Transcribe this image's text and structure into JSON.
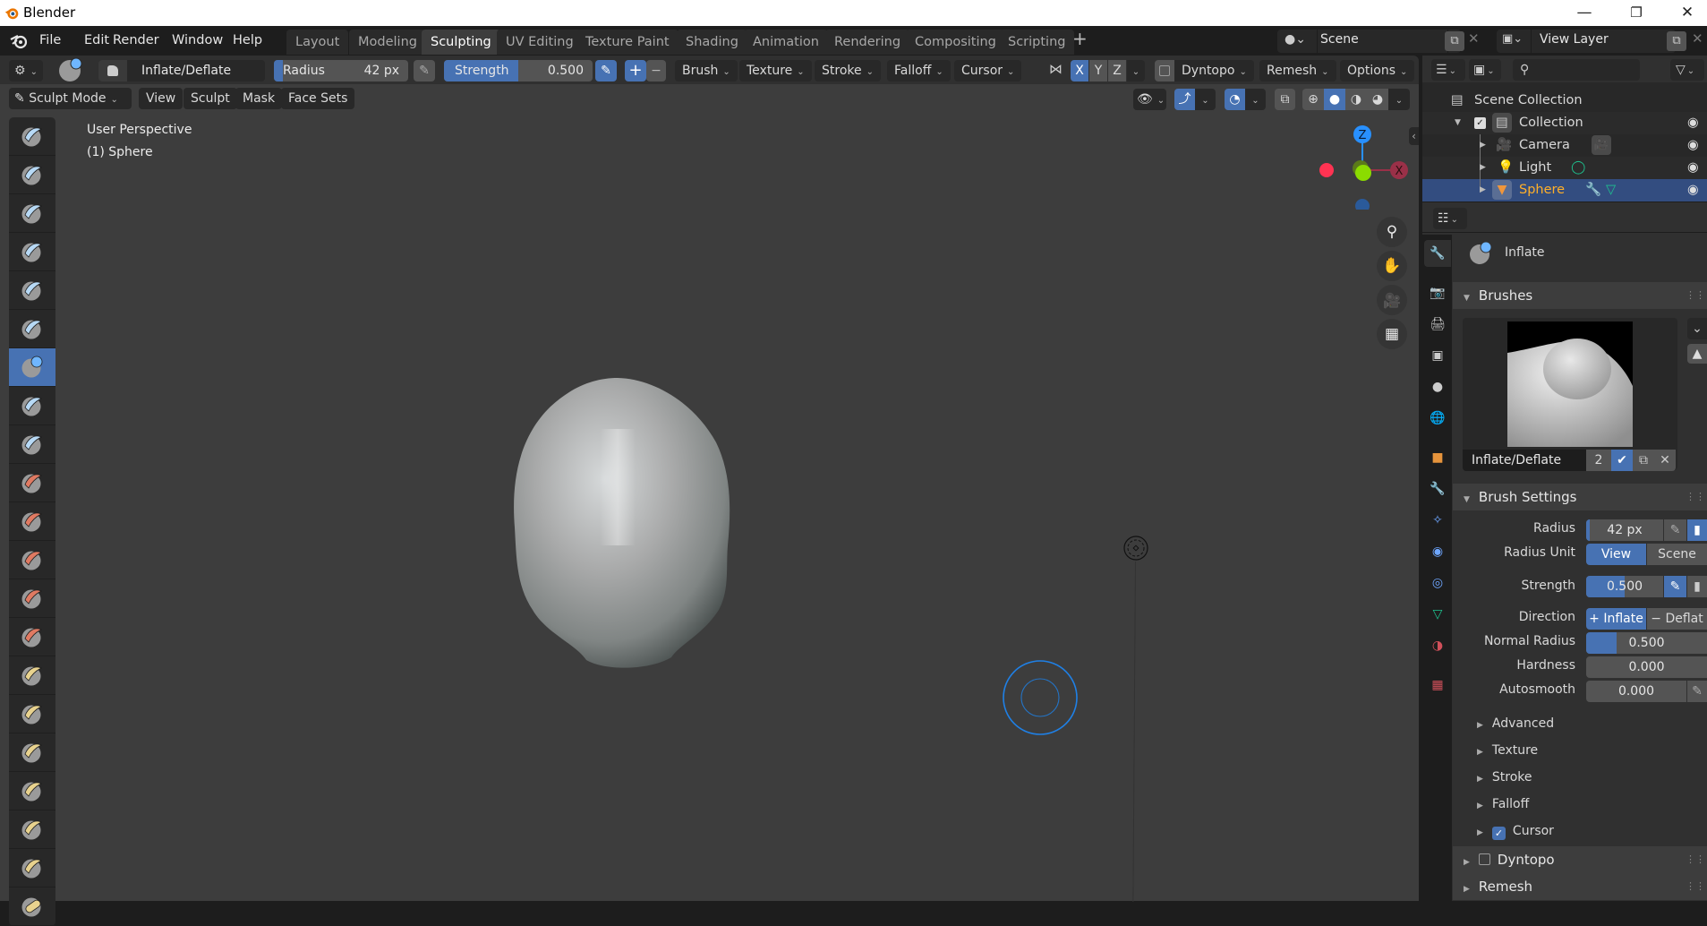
{
  "window": {
    "title": "Blender",
    "controls": [
      "minimize",
      "maximize",
      "close"
    ]
  },
  "menubar": {
    "items": [
      "File",
      "Edit",
      "Render",
      "Window",
      "Help"
    ]
  },
  "workspaces": {
    "tabs": [
      "Layout",
      "Modeling",
      "Sculpting",
      "UV Editing",
      "Texture Paint",
      "Shading",
      "Animation",
      "Rendering",
      "Compositing",
      "Scripting"
    ],
    "active": "Sculpting",
    "add_label": "+"
  },
  "scene": {
    "name": "Scene"
  },
  "view_layer": {
    "name": "View Layer"
  },
  "tool_header": {
    "brush_name": "Inflate/Deflate",
    "radius_label": "Radius",
    "radius_value": "42 px",
    "strength_label": "Strength",
    "strength_value": "0.500",
    "strength_fraction": 0.5,
    "plus": "+",
    "minus": "−",
    "menus": [
      "Brush",
      "Texture",
      "Stroke",
      "Falloff",
      "Cursor"
    ],
    "symmetry": [
      "X",
      "Y",
      "Z"
    ],
    "symmetry_active": "X",
    "dyntopo_label": "Dyntopo",
    "remesh_label": "Remesh",
    "options_label": "Options"
  },
  "mode_header": {
    "mode": "Sculpt Mode",
    "menus": [
      "View",
      "Sculpt",
      "Mask",
      "Face Sets"
    ]
  },
  "viewport": {
    "perspective_label": "User Perspective",
    "object_label": "(1) Sphere",
    "gizmo": {
      "x": "X",
      "y": "Y",
      "z": "Z"
    }
  },
  "toolbar": {
    "tools": [
      "Draw",
      "Draw Sharp",
      "Clay",
      "Clay Strips",
      "Clay Thumb",
      "Layer",
      "Inflate",
      "Blob",
      "Crease",
      "Smooth",
      "Flatten",
      "Fill",
      "Scrape",
      "Multi-plane Scrape",
      "Pinch",
      "Grab",
      "Elastic Deform",
      "Snake Hook",
      "Thumb",
      "Pose",
      "Line Project"
    ],
    "active_index": 6
  },
  "outliner": {
    "search_placeholder": "",
    "root": "Scene Collection",
    "collection": "Collection",
    "items": [
      {
        "name": "Camera",
        "type": "camera"
      },
      {
        "name": "Light",
        "type": "light"
      },
      {
        "name": "Sphere",
        "type": "mesh",
        "selected": true
      }
    ]
  },
  "properties": {
    "active_brush_label": "Inflate",
    "brushes_header": "Brushes",
    "brush_datablock": "Inflate/Deflate",
    "brush_users": "2",
    "brush_settings_header": "Brush Settings",
    "fields": {
      "radius_label": "Radius",
      "radius_value": "42 px",
      "radius_unit_label": "Radius Unit",
      "radius_unit_options": [
        "View",
        "Scene"
      ],
      "radius_unit_active": "View",
      "strength_label": "Strength",
      "strength_value": "0.500",
      "strength_fraction": 0.5,
      "direction_label": "Direction",
      "direction_options": [
        "+ Inflate",
        "− Deflat"
      ],
      "direction_active": "+ Inflate",
      "normal_radius_label": "Normal Radius",
      "normal_radius_value": "0.500",
      "normal_radius_fraction": 0.5,
      "hardness_label": "Hardness",
      "hardness_value": "0.000",
      "autosmooth_label": "Autosmooth",
      "autosmooth_value": "0.000"
    },
    "subpanels": [
      "Advanced",
      "Texture",
      "Stroke",
      "Falloff",
      "Cursor"
    ],
    "cursor_checked": true,
    "dyntopo_header": "Dyntopo",
    "dyntopo_checked": false,
    "remesh_header": "Remesh"
  },
  "colors": {
    "accent": "#4772b3",
    "selection": "#334d80",
    "viewport_bg": "#3d3d3d",
    "axis_x": "#ff3352",
    "axis_y": "#8bdc00",
    "axis_z": "#2890ff",
    "object_selected_text": "#ffaf29"
  }
}
